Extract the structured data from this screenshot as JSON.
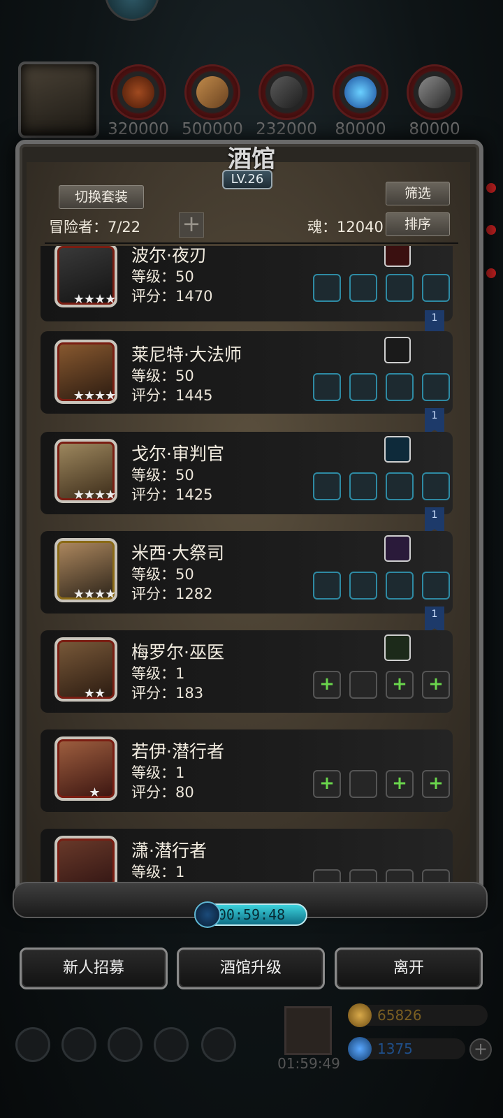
{
  "resources": {
    "counts": [
      "320000",
      "500000",
      "232000",
      "80000",
      "80000"
    ]
  },
  "tavern": {
    "title": "酒馆",
    "level": "LV.26",
    "switch_outfit_label": "切换套装",
    "filter_label": "筛选",
    "sort_label": "排序",
    "adventurers_label": "冒险者：7/22",
    "soul_label": "魂：12040",
    "add_icon": "plus-icon"
  },
  "heroes": [
    {
      "name": "波尔·夜刃",
      "level": "等级：50",
      "score": "评分：1470",
      "stars": "★★★★",
      "ribbon": "1",
      "gem_color": "#c23a1e"
    },
    {
      "name": "莱尼特·大法师",
      "level": "等级：50",
      "score": "评分：1445",
      "stars": "★★★★",
      "ribbon": "1",
      "gem_color": "#3a3a3a"
    },
    {
      "name": "戈尔·审判官",
      "level": "等级：50",
      "score": "评分：1425",
      "stars": "★★★★",
      "ribbon": "1",
      "gem_color": "#5fc8e6"
    },
    {
      "name": "米西·大祭司",
      "level": "等级：50",
      "score": "评分：1282",
      "stars": "★★★★",
      "ribbon": "1",
      "gem_color": "#9b7fcf"
    },
    {
      "name": "梅罗尔·巫医",
      "level": "等级：1",
      "score": "评分：183",
      "stars": "★★",
      "ribbon": "",
      "gem_color": "#4a9a3a"
    },
    {
      "name": "若伊·潜行者",
      "level": "等级：1",
      "score": "评分：80",
      "stars": "★",
      "ribbon": "",
      "gem_color": ""
    },
    {
      "name": "潇·潜行者",
      "level": "等级：1",
      "score": "",
      "stars": "",
      "ribbon": "",
      "gem_color": ""
    }
  ],
  "timer": "00:59:48",
  "buttons": {
    "recruit": "新人招募",
    "upgrade": "酒馆升级",
    "leave": "离开"
  },
  "dock": {
    "chest_timer": "01:59:49",
    "gold": "65826",
    "gems": "1375"
  },
  "colors": {
    "accent_slot": "#2e8aa3",
    "gold_text": "#7a5f22",
    "gem_text": "#1f4f8a"
  }
}
